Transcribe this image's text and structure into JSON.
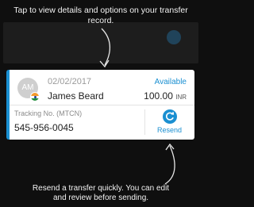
{
  "hints": {
    "top_line1": "Tap to view details and options on your transfer",
    "top_line2": "record.",
    "bottom_line1": "Resend a transfer quickly. You can edit",
    "bottom_line2": "and review before sending."
  },
  "card": {
    "avatar_initials": "AM",
    "date": "02/02/2017",
    "recipient_name": "James Beard",
    "status": "Available",
    "amount": "100.00",
    "currency": "INR",
    "tracking_label": "Tracking No. (MTCN)",
    "tracking_number": "545-956-0045",
    "resend_label": "Resend",
    "resend_icon": "refresh-icon",
    "flag_icon": "india-flag-icon",
    "accent_color": "#1a8fd1"
  }
}
